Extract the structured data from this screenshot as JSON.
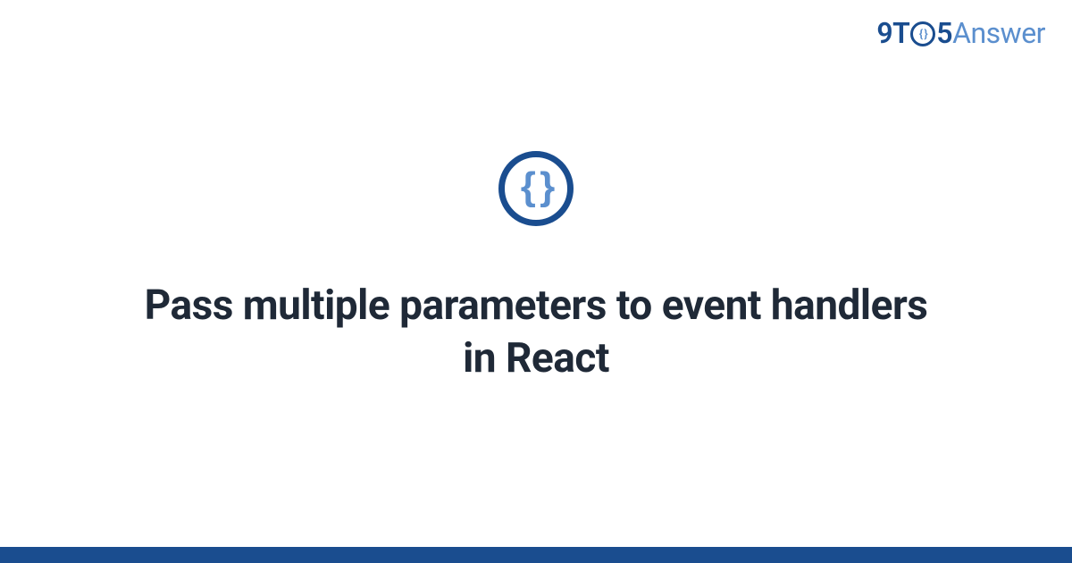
{
  "brand": {
    "part1": "9T",
    "o_inner": "{ }",
    "part2": "5",
    "part3": "Answer"
  },
  "category_icon": {
    "name": "code-braces-icon",
    "glyph": "{ }"
  },
  "main": {
    "title": "Pass multiple parameters to event handlers in React"
  },
  "colors": {
    "primary": "#1a4d8f",
    "accent": "#5b8fce",
    "text": "#1f2937"
  }
}
